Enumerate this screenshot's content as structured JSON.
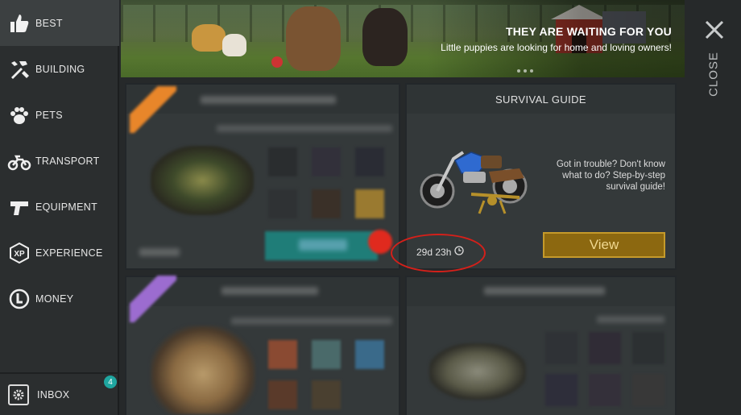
{
  "sidebar": {
    "items": [
      {
        "label": "BEST",
        "icon": "thumbs-up-icon"
      },
      {
        "label": "BUILDING",
        "icon": "tools-icon"
      },
      {
        "label": "PETS",
        "icon": "paw-icon"
      },
      {
        "label": "TRANSPORT",
        "icon": "motorcycle-icon"
      },
      {
        "label": "EQUIPMENT",
        "icon": "pistol-icon"
      },
      {
        "label": "EXPERIENCE",
        "icon": "xp-icon"
      },
      {
        "label": "MONEY",
        "icon": "coin-icon"
      }
    ],
    "inbox": {
      "label": "INBOX",
      "badge": "4",
      "icon": "gear-icon"
    }
  },
  "banner": {
    "title": "THEY ARE WAITING FOR YOU",
    "subtitle": "Little puppies are looking for home and loving owners!"
  },
  "close": {
    "label": "CLOSE"
  },
  "survival_guide": {
    "title": "SURVIVAL GUIDE",
    "description": "Got in trouble? Don't know what to do? Step-by-step survival guide!",
    "timer": "29d 23h",
    "view_label": "View"
  },
  "colors": {
    "accent_teal": "#1fa6a0",
    "view_button": "#8c6810",
    "highlight_ring": "#d4201a"
  }
}
